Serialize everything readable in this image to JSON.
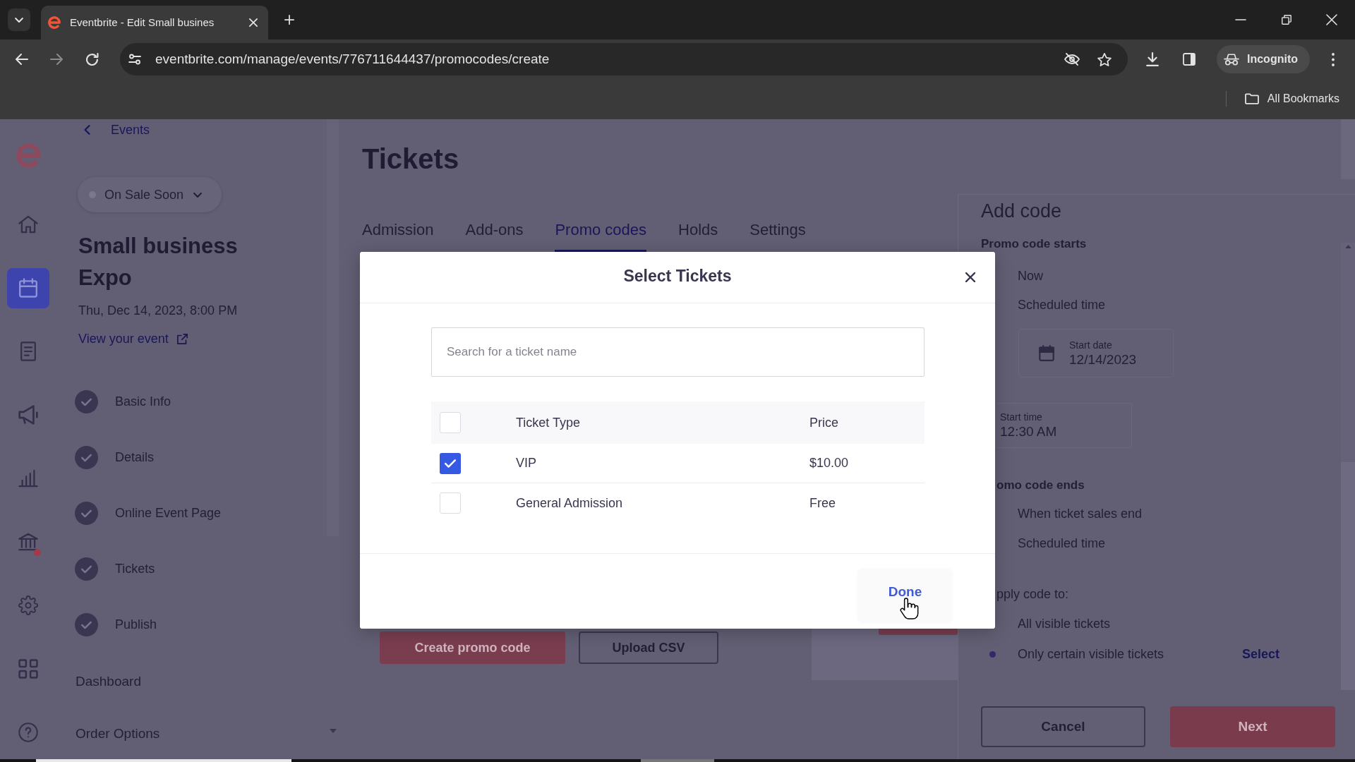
{
  "browser": {
    "tab_title": "Eventbrite - Edit Small busines",
    "url": "eventbrite.com/manage/events/776711644437/promocodes/create",
    "profile": "Incognito",
    "bookmarks_folder": "All Bookmarks"
  },
  "nav_rail": {
    "items": [
      {
        "selected": false,
        "alert": false
      },
      {
        "selected": true,
        "alert": false
      },
      {
        "selected": false,
        "alert": false
      },
      {
        "selected": false,
        "alert": false
      },
      {
        "selected": false,
        "alert": false
      },
      {
        "selected": false,
        "alert": true
      },
      {
        "selected": false,
        "alert": false
      },
      {
        "selected": false,
        "alert": false
      },
      {
        "selected": false,
        "alert": false
      }
    ]
  },
  "sidebar": {
    "back_link": "Events",
    "status": "On Sale Soon",
    "event_title": "Small business Expo",
    "event_date": "Thu, Dec 14, 2023, 8:00 PM",
    "view_link": "View your event",
    "steps": [
      {
        "label": "Basic Info",
        "done": true
      },
      {
        "label": "Details",
        "done": true
      },
      {
        "label": "Online Event Page",
        "done": true
      },
      {
        "label": "Tickets",
        "done": true
      },
      {
        "label": "Publish",
        "done": true
      }
    ],
    "links": [
      "Dashboard",
      "Order Options"
    ]
  },
  "main": {
    "title": "Tickets",
    "tabs": [
      {
        "label": "Admission",
        "selected": false
      },
      {
        "label": "Add-ons",
        "selected": false
      },
      {
        "label": "Promo codes",
        "selected": true
      },
      {
        "label": "Holds",
        "selected": false
      },
      {
        "label": "Settings",
        "selected": false
      }
    ],
    "actions": [
      {
        "label": "Create promo code",
        "kind": "primary"
      },
      {
        "label": "Upload CSV",
        "kind": "secondary"
      }
    ]
  },
  "add_code": {
    "title": "Add code",
    "starts": {
      "heading": "Promo code starts",
      "options": [
        "Now",
        "Scheduled time"
      ],
      "start_date": {
        "label": "Start date",
        "value": "12/14/2023"
      },
      "start_time": {
        "label": "Start time",
        "value": "12:30 AM"
      }
    },
    "ends": {
      "heading": "omo code ends",
      "options": [
        "When ticket sales end",
        "Scheduled time"
      ]
    },
    "apply_to": {
      "heading": "pply code to:",
      "options": [
        {
          "label": "All visible tickets",
          "selected": false
        },
        {
          "label": "Only certain visible tickets",
          "selected": true
        }
      ],
      "select_link": "Select"
    },
    "buttons": [
      {
        "label": "Cancel",
        "kind": "secondary"
      },
      {
        "label": "Next",
        "kind": "primary"
      }
    ]
  },
  "modal": {
    "title": "Select Tickets",
    "search": {
      "placeholder": "Search for a ticket name"
    },
    "table": {
      "columns": [
        "Ticket Type",
        "Price"
      ],
      "select_all_checked": false,
      "rows": [
        {
          "cells": [
            "VIP",
            "$10.00"
          ],
          "checked": true
        },
        {
          "cells": [
            "General Admission",
            "Free"
          ],
          "checked": false
        }
      ]
    },
    "done_button": "Done"
  }
}
